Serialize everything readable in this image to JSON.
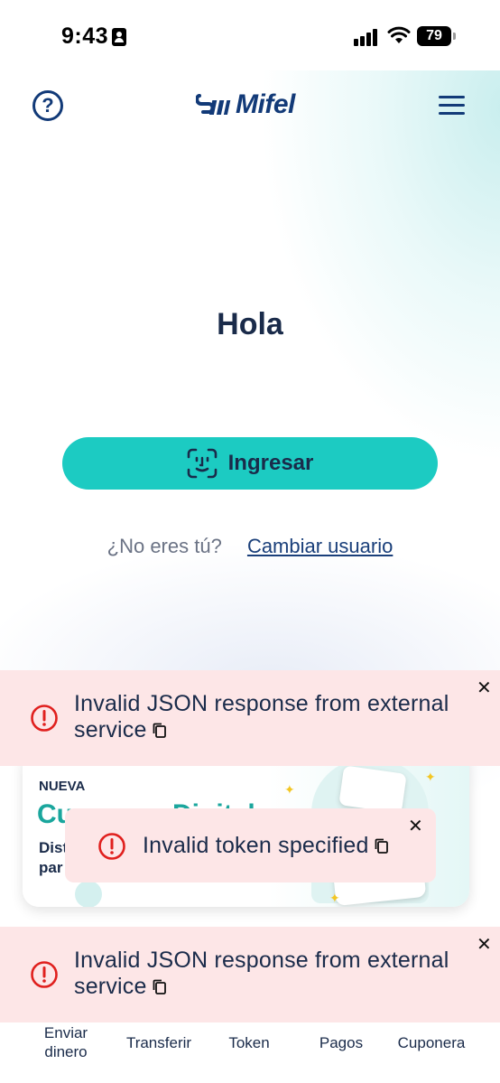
{
  "status_bar": {
    "time": "9:43",
    "battery": "79",
    "icons": [
      "person-badge-icon",
      "cellular-signal-icon",
      "wifi-icon",
      "battery-icon"
    ]
  },
  "header": {
    "help_icon": "question-circle-icon",
    "help_glyph": "?",
    "logo_text": "Mifel",
    "menu_icon": "hamburger-menu-icon"
  },
  "main": {
    "greeting": "Hola",
    "login_button_label": "Ingresar",
    "login_icon": "face-id-icon",
    "not_you_question": "¿No eres tú?",
    "change_user_link": "Cambiar usuario"
  },
  "promo": {
    "badge": "NUEVA",
    "title_partial_left": "Cu",
    "title_partial_right": "Digital",
    "desc_line1": "Dist",
    "desc_line2": "par"
  },
  "toasts": [
    {
      "message_line1": "Invalid JSON response from external",
      "message_line2": "service"
    },
    {
      "message": "Invalid token specified"
    },
    {
      "message_line1": "Invalid JSON response from external",
      "message_line2": "service"
    }
  ],
  "bottom_nav": {
    "items": [
      {
        "label_line1": "Enviar",
        "label_line2": "dinero"
      },
      {
        "label": "Transferir"
      },
      {
        "label": "Token"
      },
      {
        "label": "Pagos"
      },
      {
        "label": "Cuponera"
      }
    ]
  },
  "colors": {
    "brand_navy": "#123a78",
    "accent_teal": "#1ccbc2",
    "toast_bg": "#fde6e7",
    "error_red": "#e0201e"
  }
}
